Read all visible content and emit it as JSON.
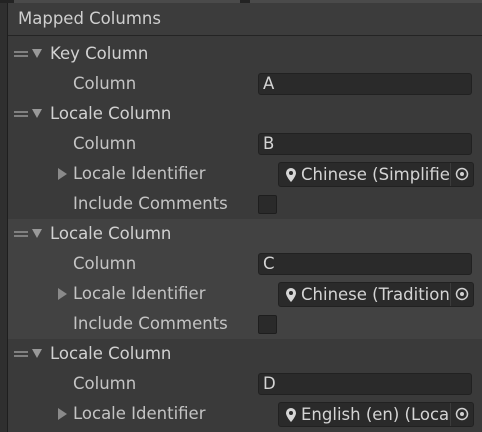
{
  "panel": {
    "title": "Mapped Columns"
  },
  "columns": [
    {
      "title": "Key Column",
      "column_label": "Column",
      "column_value": "A"
    },
    {
      "title": "Locale Column",
      "column_label": "Column",
      "column_value": "B",
      "locale_label": "Locale Identifier",
      "locale_value": "Chinese (Simplified)",
      "comments_label": "Include Comments",
      "include_comments": false
    },
    {
      "title": "Locale Column",
      "column_label": "Column",
      "column_value": "C",
      "locale_label": "Locale Identifier",
      "locale_value": "Chinese (Traditional)",
      "comments_label": "Include Comments",
      "include_comments": false
    },
    {
      "title": "Locale Column",
      "column_label": "Column",
      "column_value": "D",
      "locale_label": "Locale Identifier",
      "locale_value": "English (en) (Locale)"
    }
  ],
  "icons": {
    "drag": "drag-handle-icon",
    "foldout": "triangle-down-icon",
    "collapsed": "triangle-right-icon",
    "locale": "map-pin-icon",
    "picker": "object-picker-icon"
  },
  "colors": {
    "panel_bg": "#3a3a3a",
    "alt_bg": "#424242",
    "field_bg": "#2a2a2a",
    "text": "#c4c4c4"
  }
}
